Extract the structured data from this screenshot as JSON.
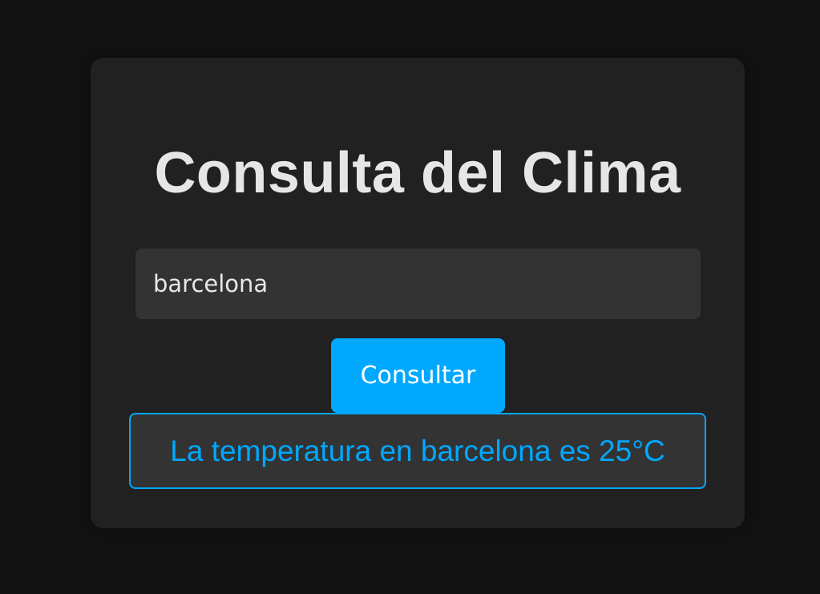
{
  "app": {
    "title": "Consulta del Clima"
  },
  "search": {
    "value": "barcelona",
    "button_label": "Consultar"
  },
  "result": {
    "text": "La temperatura en barcelona es 25°C"
  },
  "colors": {
    "page_background": "#121212",
    "card_background": "#212121",
    "input_background": "#333333",
    "accent": "#00a8ff",
    "title_text": "#e6e6e6"
  }
}
